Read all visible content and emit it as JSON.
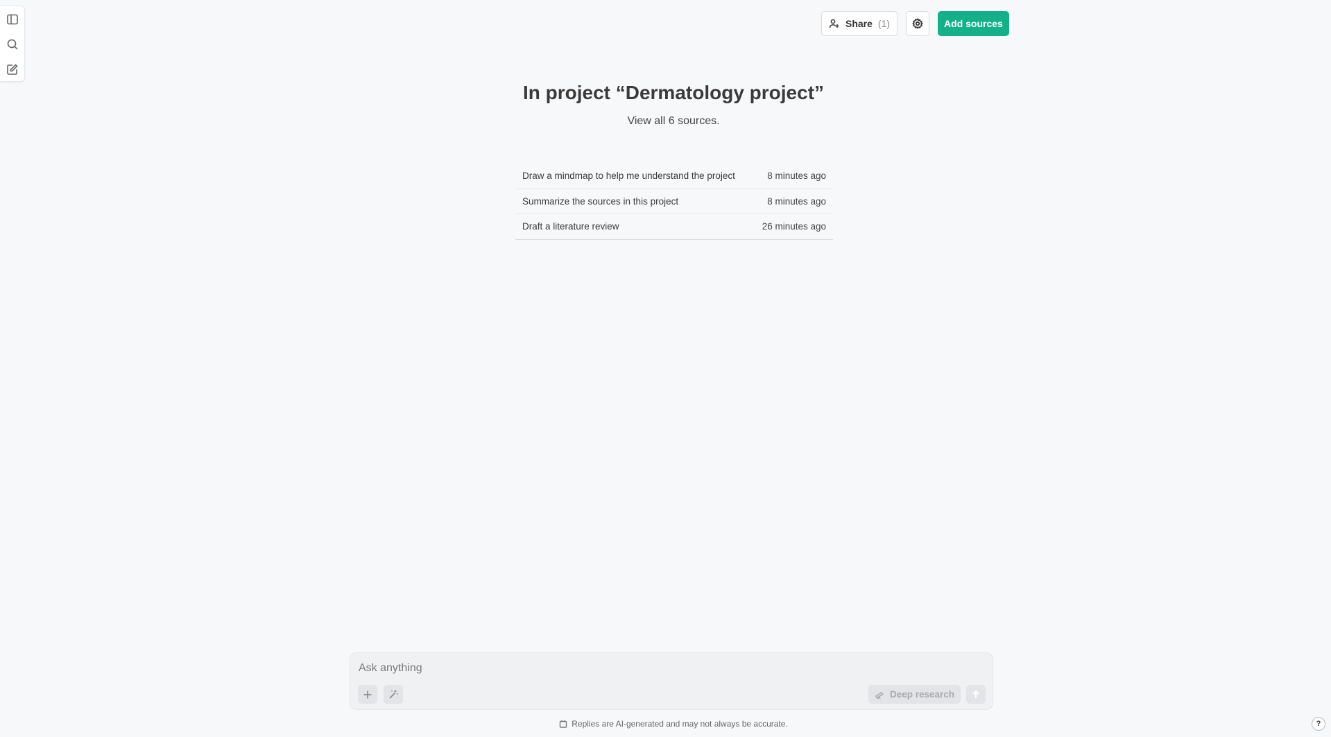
{
  "rail": {
    "icons": [
      "sidebar-toggle-icon",
      "search-icon",
      "new-chat-icon"
    ]
  },
  "toolbar": {
    "share_label": "Share",
    "share_count": "(1)",
    "add_sources_label": "Add sources"
  },
  "main": {
    "title": "In project “Dermatology project”",
    "subtitle": "View all 6 sources."
  },
  "recent": [
    {
      "label": "Draw a mindmap to help me understand the project",
      "time": "8 minutes ago"
    },
    {
      "label": "Summarize the sources in this project",
      "time": "8 minutes ago"
    },
    {
      "label": "Draft a literature review",
      "time": "26 minutes ago"
    }
  ],
  "composer": {
    "placeholder": "Ask anything",
    "deep_research_label": "Deep research"
  },
  "footer": {
    "disclaimer": "Replies are AI-generated and may not always be accurate.",
    "help_label": "?"
  },
  "colors": {
    "accent": "#14b08a",
    "background": "#f7f8fa"
  }
}
